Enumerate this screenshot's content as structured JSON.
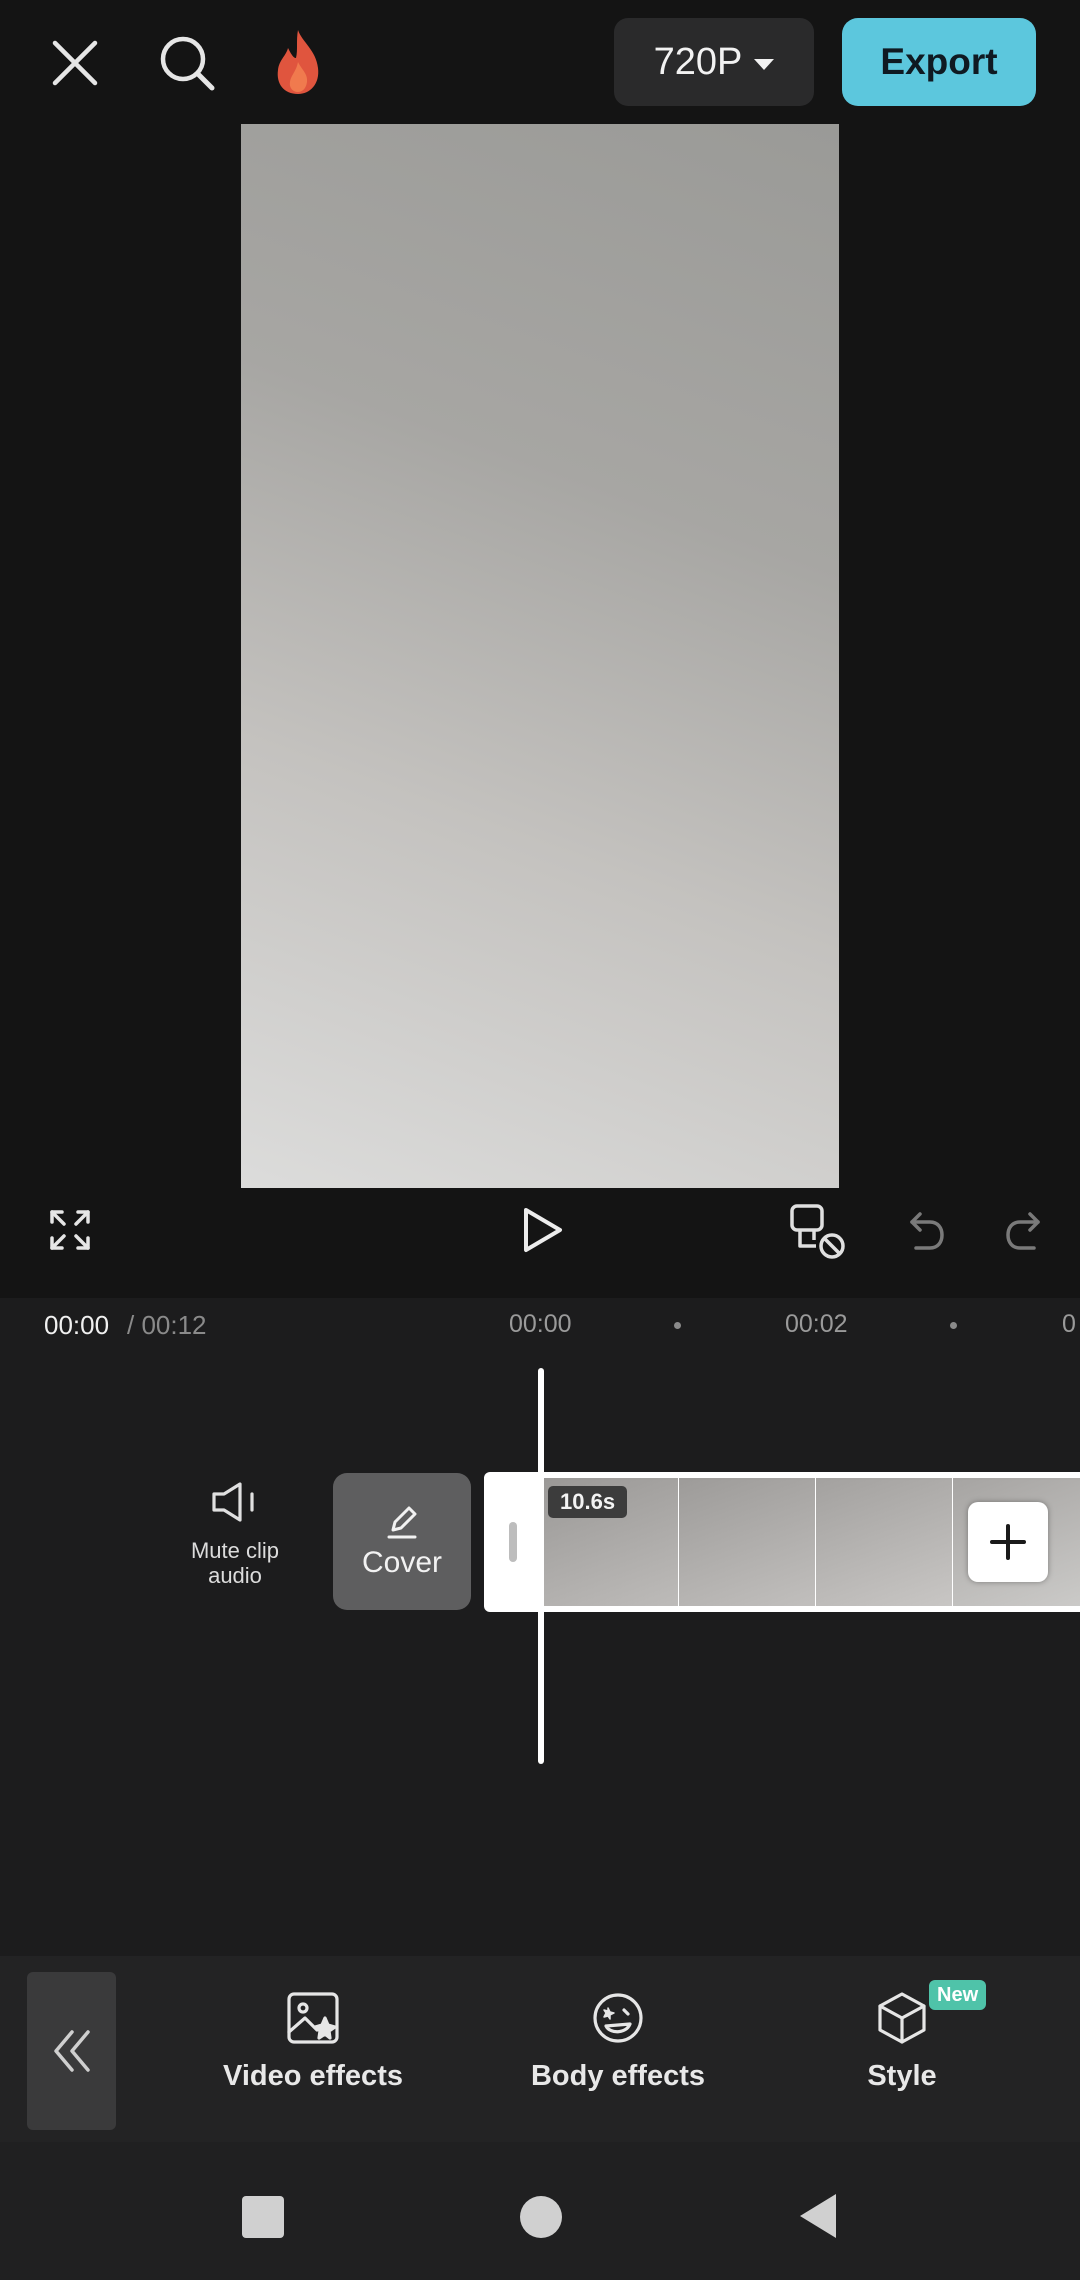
{
  "topbar": {
    "close_icon": "close-icon",
    "search_icon": "search-icon",
    "promo_icon": "flame-icon",
    "resolution": "720P",
    "export_label": "Export",
    "export_color": "#5cc7dd"
  },
  "preview": {
    "controls": {
      "fullscreen_icon": "fullscreen-icon",
      "play_icon": "play-icon",
      "keyframe_icon": "keyframe-off-icon",
      "undo_icon": "undo-icon",
      "redo_icon": "redo-icon"
    }
  },
  "timeline": {
    "current_time": "00:00",
    "total_time": "/ 00:12",
    "ticks": [
      "00:00",
      "00:02"
    ],
    "tick_partial": "0",
    "mute_label_line1": "Mute clip",
    "mute_label_line2": "audio",
    "cover_label": "Cover",
    "clip_duration": "10.6s"
  },
  "toolbar": {
    "collapse_icon": "double-chevron-left-icon",
    "items": [
      {
        "label": "Video effects",
        "icon": "video-effects-icon"
      },
      {
        "label": "Body effects",
        "icon": "body-effects-icon"
      },
      {
        "label": "Style",
        "icon": "cube-icon",
        "badge": "New"
      }
    ],
    "badge_color": "#4fc3a9"
  },
  "system_nav": {
    "recents_icon": "square-icon",
    "home_icon": "circle-icon",
    "back_icon": "triangle-back-icon"
  }
}
